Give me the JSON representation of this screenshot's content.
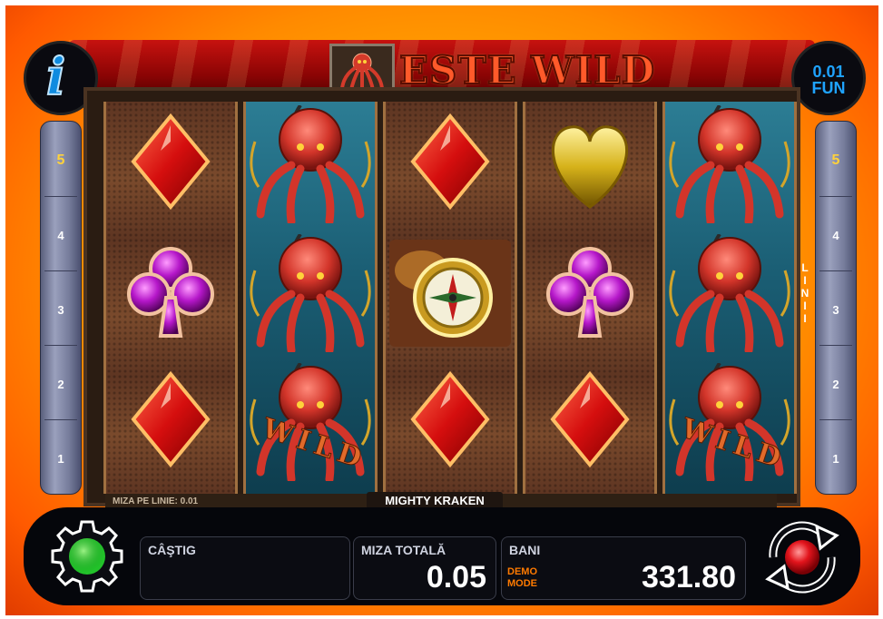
{
  "header": {
    "game_logo_text": "ESTE WILD",
    "info_label": "i",
    "denomination": [
      "0.01",
      "FUN"
    ]
  },
  "lines_panel": {
    "label": "LINII",
    "numbers": [
      "5",
      "4",
      "3",
      "2",
      "1"
    ],
    "active": "5"
  },
  "reels": [
    [
      "red-diamond",
      "purple-club",
      "red-diamond"
    ],
    [
      "octopus-wild",
      "octopus-wild",
      "octopus-wild"
    ],
    [
      "red-diamond",
      "compass",
      "red-diamond"
    ],
    [
      "gold-heart",
      "purple-club",
      "red-diamond"
    ],
    [
      "octopus-wild",
      "octopus-wild",
      "octopus-wild"
    ]
  ],
  "wild_text": "WILD",
  "footer": {
    "bet_per_line": "MIZA PE LINIE: 0.01",
    "game_name": "MIGHTY KRAKEN",
    "win_label": "CÂŞTIG",
    "win_value": "",
    "total_bet_label": "MIZA TOTALĂ",
    "total_bet_value": "0.05",
    "balance_label": "BANI",
    "demo_label": [
      "DEMO",
      "MODE"
    ],
    "balance_value": "331.80"
  },
  "colors": {
    "background": "#ffa200",
    "accent_blue": "#1fa3ff",
    "active_line": "#ffd23a",
    "demo": "#ff7a00",
    "settings_green": "#22c22a",
    "spin_red": "#e2141c"
  },
  "icons": {
    "info": "info-icon",
    "settings": "gear-icon",
    "spin": "spin-arrows-icon"
  }
}
